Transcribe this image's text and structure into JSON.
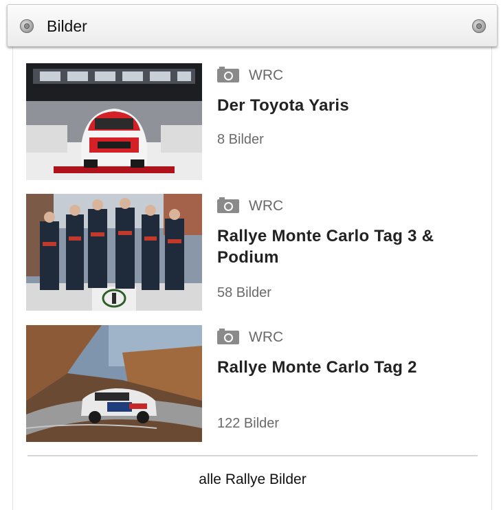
{
  "header": {
    "title": "Bilder"
  },
  "gallery": {
    "items": [
      {
        "category": "WRC",
        "title": "Der Toyota Yaris",
        "count": "8 Bilder",
        "thumbnail": "toyota-yaris-showroom"
      },
      {
        "category": "WRC",
        "title": "Rallye Monte Carlo Tag 3 & Podium",
        "count": "58 Bilder",
        "thumbnail": "podium-team-photo"
      },
      {
        "category": "WRC",
        "title": "Rallye Monte Carlo Tag 2",
        "count": "122 Bilder",
        "thumbnail": "rally-car-forest-road"
      }
    ]
  },
  "footer": {
    "all_link": "alle Rallye Bilder"
  },
  "colors": {
    "text_dark": "#222222",
    "text_muted": "#6a6a6a",
    "icon_gray": "#8a8a8a",
    "divider": "#d6d6d6"
  }
}
